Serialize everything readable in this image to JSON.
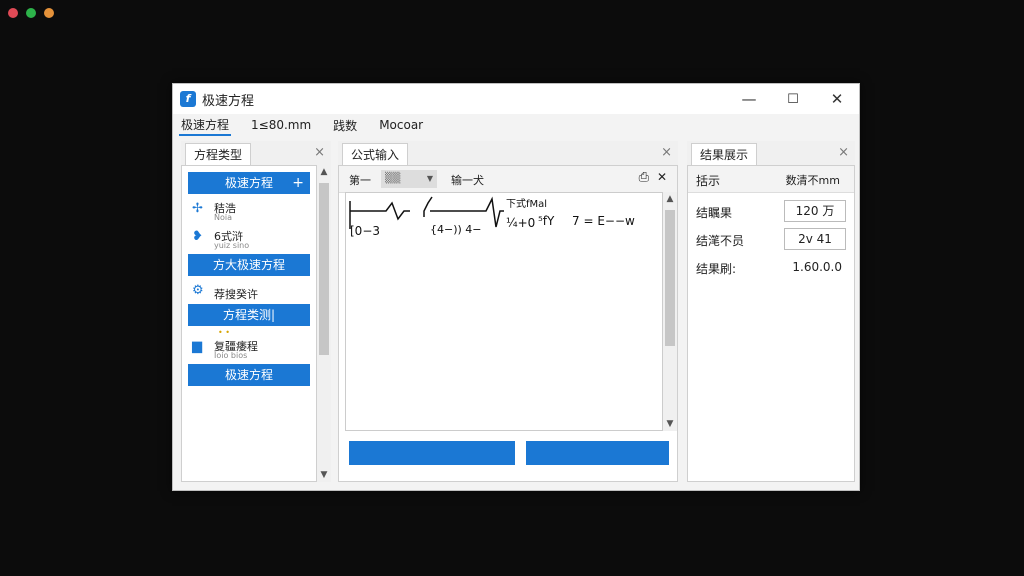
{
  "window": {
    "title": "极速方程",
    "controls": {
      "minimize": "—",
      "maximize": "☐",
      "close": "✕"
    }
  },
  "menu": [
    "极速方程",
    "1≤80.mm",
    "践数",
    "Mocoar"
  ],
  "left_panel": {
    "tab": "方程类型",
    "close": "×",
    "buttons": {
      "b1": "极速方程",
      "b1_plus": "+",
      "b2": "方大极速方程",
      "b3": "方程类测|",
      "b4": "极速方程"
    },
    "items": [
      {
        "icon": "✢",
        "main": "秸浩",
        "sub": "Ñoia"
      },
      {
        "icon": "❥",
        "main": "6式浒",
        "sub": "yuiz sino"
      },
      {
        "icon": "⚙",
        "main": "荐搜癸许",
        "sub": ""
      },
      {
        "icon": "▆",
        "main": "复疆痿程",
        "sub": "Ioio bios"
      }
    ],
    "mark": "• •",
    "scroll": {
      "up": "▲",
      "down": "▼"
    }
  },
  "center_panel": {
    "tab": "公式输入",
    "close": "×",
    "toolbar": {
      "t1": "第一",
      "combo": "▒▒",
      "combo_arrow": "▼",
      "t2": "输一犬",
      "print_icon": "⎙",
      "close": "✕"
    },
    "formula": {
      "label": "下式fMal",
      "a": "[0−3",
      "b": "{4−)) 4−",
      "c": "¼+0",
      "d": "⁵fY",
      "e": "7 = E−−w"
    },
    "scroll": {
      "up": "▲",
      "down": "▼"
    }
  },
  "right_panel": {
    "tab": "结果展示",
    "close": "×",
    "header": {
      "left": "括示",
      "right": "数清不mm"
    },
    "rows": [
      {
        "label": "结瞩果",
        "value": "120  万"
      },
      {
        "label": "结滗不员",
        "value": "2v    41"
      },
      {
        "label": "结果刷:",
        "value": "1.60.0.0"
      }
    ]
  },
  "colors": {
    "accent": "#1b78d4",
    "background": "#0c0c0c",
    "dot_red": "#e04a56",
    "dot_green": "#2db34a",
    "dot_orange": "#e5923a"
  }
}
